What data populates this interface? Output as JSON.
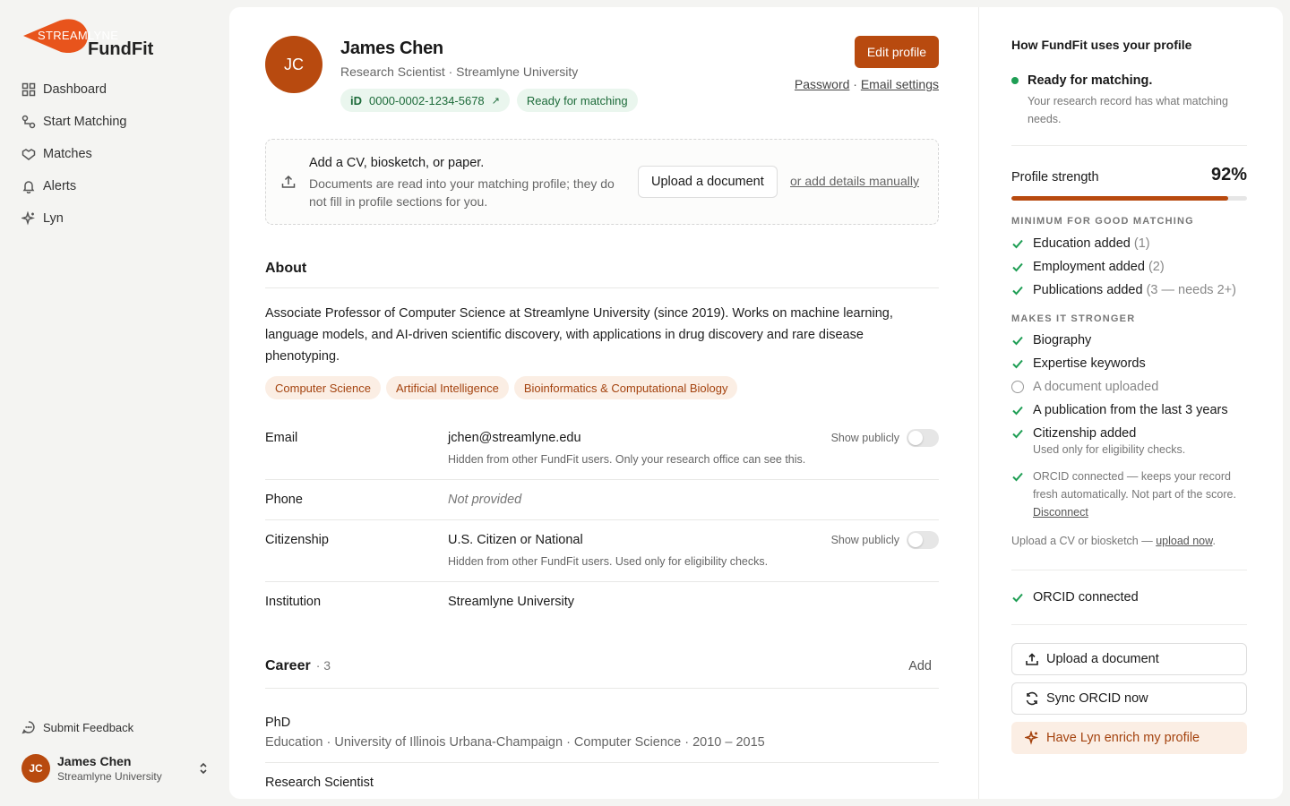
{
  "brand": {
    "top": "STREAMLYNE",
    "main": "FundFit"
  },
  "nav": [
    {
      "label": "Dashboard",
      "icon": "dashboard-icon"
    },
    {
      "label": "Start Matching",
      "icon": "flow-icon"
    },
    {
      "label": "Matches",
      "icon": "handshake-icon"
    },
    {
      "label": "Alerts",
      "icon": "bell-icon"
    },
    {
      "label": "Lyn",
      "icon": "sparkle-icon"
    }
  ],
  "feedback": "Submit Feedback",
  "user": {
    "initials": "JC",
    "name": "James Chen",
    "org": "Streamlyne University"
  },
  "profile": {
    "initials": "JC",
    "name": "James Chen",
    "subtitle": "Research Scientist · Streamlyne University",
    "orcid_icon": "iD",
    "orcid": "0000-0002-1234-5678",
    "orcid_arrow": "↗",
    "status_pill": "Ready for matching",
    "edit_label": "Edit profile",
    "password_link": "Password",
    "link_sep": " · ",
    "email_settings_link": "Email settings"
  },
  "upload": {
    "title": "Add a CV, biosketch, or paper.",
    "desc": "Documents are read into your matching profile; they do not fill in profile sections for you.",
    "button": "Upload a document",
    "manual_link": "or add details manually"
  },
  "about": {
    "title": "About",
    "text": "Associate Professor of Computer Science at Streamlyne University (since 2019). Works on machine learning, language models, and AI-driven scientific discovery, with applications in drug discovery and rare disease phenotyping.",
    "tags": [
      "Computer Science",
      "Artificial Intelligence",
      "Bioinformatics & Computational Biology"
    ]
  },
  "fields": {
    "email": {
      "label": "Email",
      "value": "jchen@streamlyne.edu",
      "note": "Hidden from other FundFit users. Only your research office can see this.",
      "toggle_label": "Show publicly"
    },
    "phone": {
      "label": "Phone",
      "value": "Not provided"
    },
    "citizenship": {
      "label": "Citizenship",
      "value": "U.S. Citizen or National",
      "note": "Hidden from other FundFit users. Used only for eligibility checks.",
      "toggle_label": "Show publicly"
    },
    "institution": {
      "label": "Institution",
      "value": "Streamlyne University"
    }
  },
  "career": {
    "title": "Career",
    "count": "· 3",
    "add": "Add",
    "items": [
      {
        "title": "PhD",
        "meta": "Education · University of Illinois Urbana-Champaign · Computer Science · 2010 – 2015"
      },
      {
        "title": "Research Scientist",
        "meta": ""
      }
    ]
  },
  "sidebar_right": {
    "heading": "How FundFit uses your profile",
    "ready_title": "Ready for matching.",
    "ready_desc": "Your research record has what matching needs.",
    "strength_label": "Profile strength",
    "strength_value": "92%",
    "strength_fraction": 0.92,
    "min_caption": "MINIMUM FOR GOOD MATCHING",
    "min_items": [
      {
        "label": "Education added",
        "detail": "(1)"
      },
      {
        "label": "Employment added",
        "detail": "(2)"
      },
      {
        "label": "Publications added",
        "detail": "(3 — needs 2+)"
      }
    ],
    "stronger_caption": "MAKES IT STRONGER",
    "stronger_items": [
      {
        "label": "Biography",
        "done": true
      },
      {
        "label": "Expertise keywords",
        "done": true
      },
      {
        "label": "A document uploaded",
        "done": false
      },
      {
        "label": "A publication from the last 3 years",
        "done": true
      },
      {
        "label": "Citizenship added",
        "done": true,
        "sub": "Used only for eligibility checks."
      }
    ],
    "orcid_note": "ORCID connected — keeps your record fresh automatically. Not part of the score.",
    "disconnect": "Disconnect",
    "upload_cv_prefix": "Upload a CV or biosketch — ",
    "upload_now": "upload now",
    "upload_cv_suffix": ".",
    "orcid_connected": "ORCID connected",
    "btn_upload": "Upload a document",
    "btn_sync": "Sync ORCID now",
    "btn_lyn": "Have Lyn enrich my profile"
  },
  "colors": {
    "accent": "#b84a0f",
    "success": "#1e9e54",
    "tag_bg": "#fbeee4"
  }
}
